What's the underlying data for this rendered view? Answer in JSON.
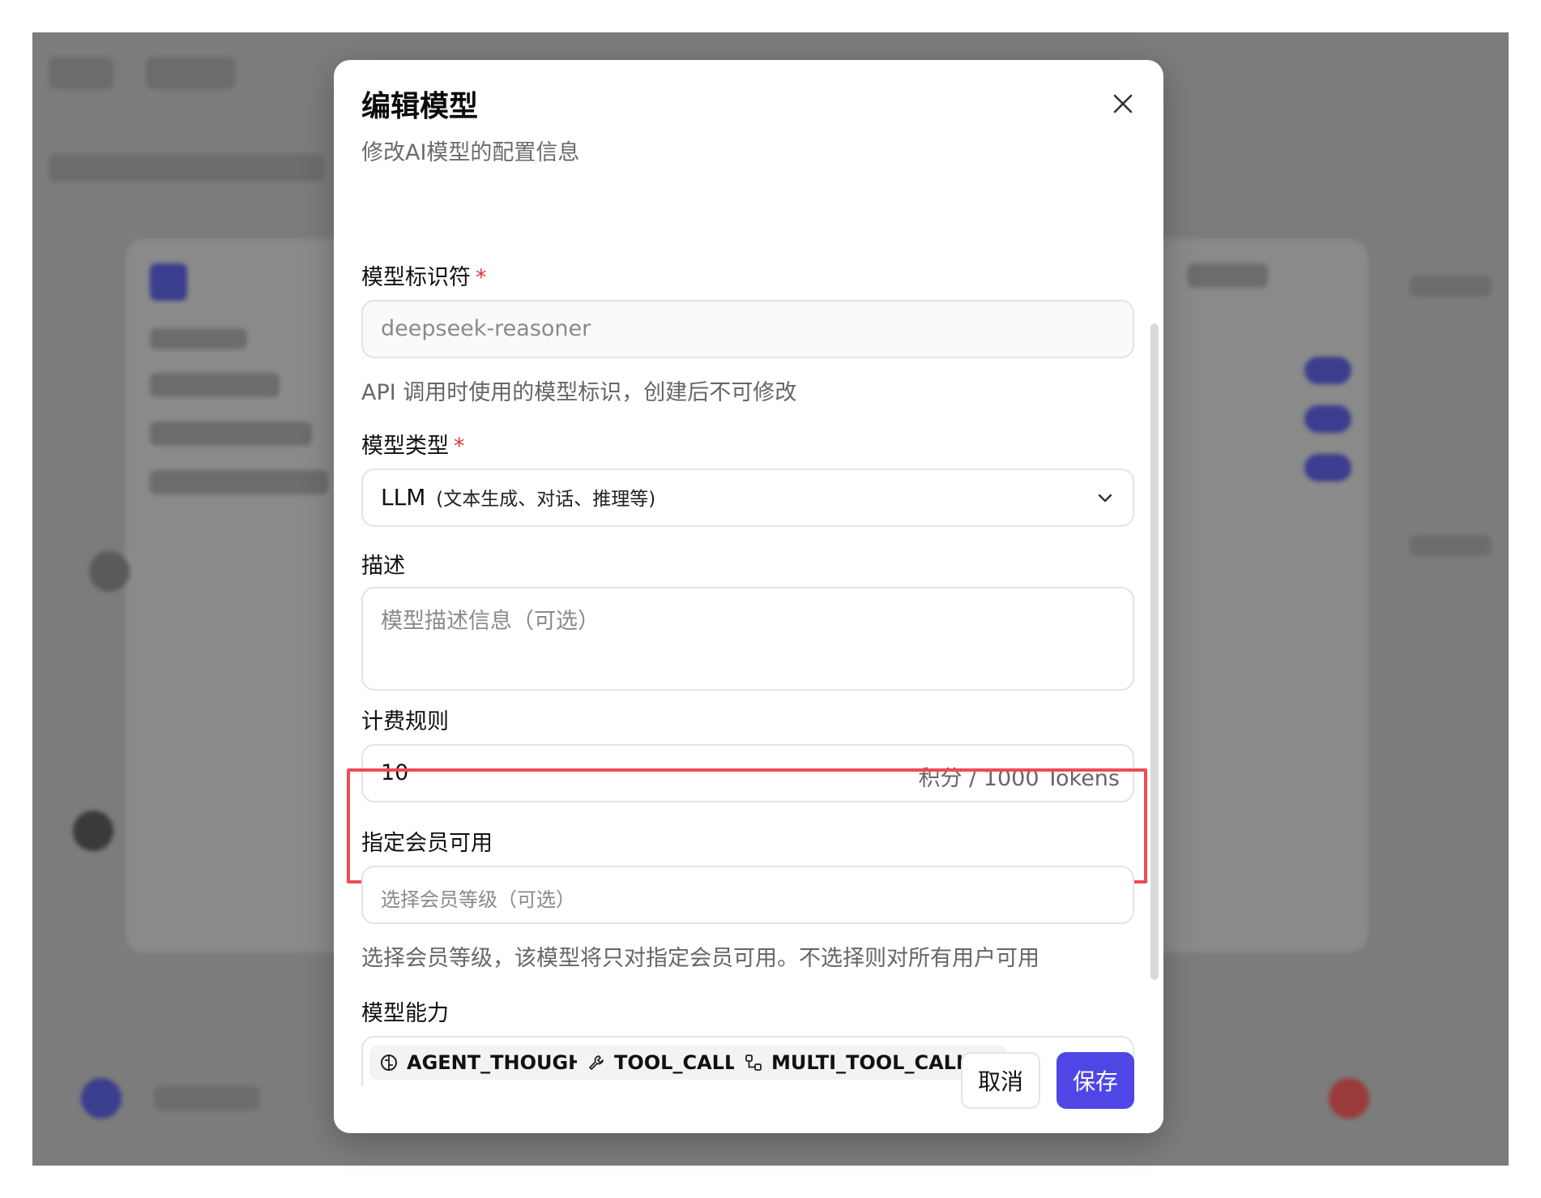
{
  "modal": {
    "title": "编辑模型",
    "subtitle": "修改AI模型的配置信息"
  },
  "fields": {
    "identifier": {
      "label": "模型标识符",
      "required_mark": "*",
      "value": "deepseek-reasoner",
      "help": "API 调用时使用的模型标识，创建后不可修改"
    },
    "type": {
      "label": "模型类型",
      "required_mark": "*",
      "selected_main": "LLM",
      "selected_detail": "(文本生成、对话、推理等)"
    },
    "description": {
      "label": "描述",
      "placeholder": "模型描述信息（可选）"
    },
    "billing": {
      "label": "计费规则",
      "value": "10",
      "unit": "积分 / 1000 Tokens"
    },
    "membership": {
      "label": "指定会员可用",
      "placeholder": "选择会员等级（可选）",
      "help": "选择会员等级，该模型将只对指定会员可用。不选择则对所有用户可用"
    },
    "capabilities": {
      "label": "模型能力",
      "chips": [
        {
          "label": "AGENT_THOUGHT",
          "icon": "brain-icon"
        },
        {
          "label": "TOOL_CALL",
          "icon": "wrench-icon"
        },
        {
          "label": "MULTI_TOOL_CALL",
          "icon": "workflow-icon"
        }
      ]
    }
  },
  "buttons": {
    "cancel": "取消",
    "save": "保存"
  },
  "colors": {
    "accent": "#4f46e5",
    "required": "#e3342f",
    "highlight": "#ef4b55"
  }
}
